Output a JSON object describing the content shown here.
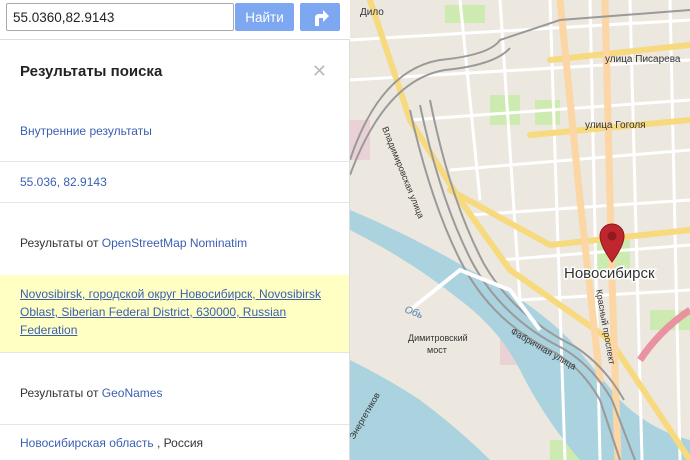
{
  "search": {
    "value": "55.0360,82.9143",
    "go_label": "Найти"
  },
  "sidebar": {
    "title": "Результаты поиска",
    "internal_results_label": "Внутренние результаты",
    "coords_result": "55.036, 82.9143",
    "osm_prefix": "Результаты от ",
    "osm_source": "OpenStreetMap Nominatim",
    "osm_result": "Novosibirsk, городской округ Новосибирск, Novosibirsk Oblast, Siberian Federal District, 630000, Russian Federation",
    "geonames_prefix": "Результаты от ",
    "geonames_source": "GeoNames",
    "geonames_result_link": "Новосибирская область",
    "geonames_result_rest": " , Россия"
  },
  "map": {
    "city_label": "Новосибирск",
    "street_pisareva": "улица Писарева",
    "street_gogolya": "улица Гоголя",
    "street_vladimirovskaya": "Владимировская улица",
    "street_fabrichnaya": "Фабричная улица",
    "street_krasny": "Красный проспект",
    "street_energetikov": "Энергетиков",
    "bridge_label_1": "Димитровский",
    "bridge_label_2": "мост",
    "river_label": "Обь",
    "top_label": "Дило",
    "marker_color": "#c0262d"
  }
}
